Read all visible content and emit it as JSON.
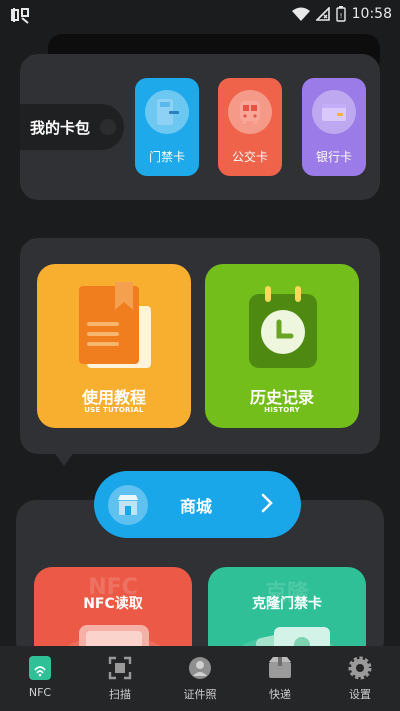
{
  "status_bar": {
    "time": "10:58",
    "icons": [
      "app-logo-icon",
      "wifi-icon",
      "no-signal-icon",
      "battery-icon"
    ]
  },
  "wallet": {
    "label": "我的卡包",
    "cards": [
      {
        "label": "门禁卡",
        "icon": "access-card-icon",
        "color": "#1ea9ea"
      },
      {
        "label": "公交卡",
        "icon": "bus-icon",
        "color": "#f0634b"
      },
      {
        "label": "银行卡",
        "icon": "wallet-icon",
        "color": "#9b7be8"
      }
    ]
  },
  "tiles": {
    "tutorial": {
      "title": "使用教程",
      "subtitle": "USE TUTORIAL",
      "icon": "book-icon",
      "color": "#f8ae2e"
    },
    "history": {
      "title": "历史记录",
      "subtitle": "HISTORY",
      "icon": "clock-icon",
      "color": "#74be1c"
    }
  },
  "shop": {
    "label": "商城",
    "icon": "store-icon"
  },
  "bottom_cards": {
    "nfc": {
      "title": "NFC读取",
      "ghost": "NFC",
      "color": "#ec5a47"
    },
    "clone": {
      "title": "克隆门禁卡",
      "ghost": "克隆",
      "color": "#2fc097"
    }
  },
  "tabs": [
    {
      "label": "NFC",
      "icon": "nfc-icon",
      "active": true
    },
    {
      "label": "扫描",
      "icon": "scan-icon",
      "active": false
    },
    {
      "label": "证件照",
      "icon": "id-photo-icon",
      "active": false
    },
    {
      "label": "快递",
      "icon": "package-icon",
      "active": false
    },
    {
      "label": "设置",
      "icon": "gear-icon",
      "active": false
    }
  ]
}
